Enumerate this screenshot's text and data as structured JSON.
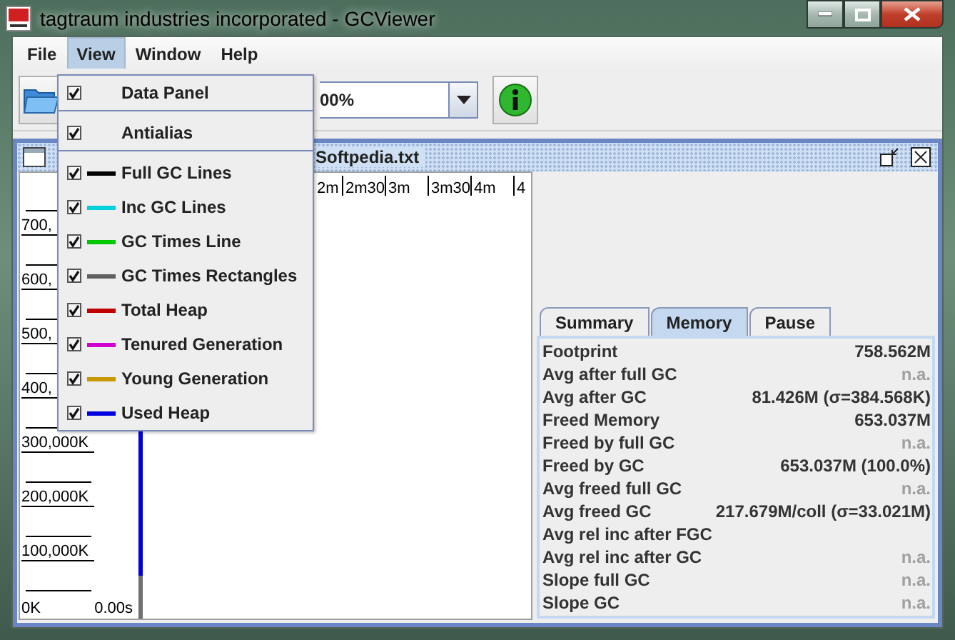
{
  "window": {
    "title": "tagtraum industries incorporated - GCViewer"
  },
  "menu_bar": [
    {
      "label": "File",
      "selected": false
    },
    {
      "label": "View",
      "selected": true
    },
    {
      "label": "Window",
      "selected": false
    },
    {
      "label": "Help",
      "selected": false
    }
  ],
  "view_menu": [
    {
      "kind": "check",
      "label": "Data Panel",
      "checked": true
    },
    {
      "kind": "separator"
    },
    {
      "kind": "check",
      "label": "Antialias",
      "checked": true
    },
    {
      "kind": "separator"
    },
    {
      "kind": "check",
      "label": "Full GC Lines",
      "checked": true,
      "color": "#000000"
    },
    {
      "kind": "check",
      "label": "Inc GC Lines",
      "checked": true,
      "color": "#00d0d8"
    },
    {
      "kind": "check",
      "label": "GC Times Line",
      "checked": true,
      "color": "#00c800"
    },
    {
      "kind": "check",
      "label": "GC Times Rectangles",
      "checked": true,
      "color": "#606060"
    },
    {
      "kind": "check",
      "label": "Total Heap",
      "checked": true,
      "color": "#c00000"
    },
    {
      "kind": "check",
      "label": "Tenured Generation",
      "checked": true,
      "color": "#d000d0"
    },
    {
      "kind": "check",
      "label": "Young Generation",
      "checked": true,
      "color": "#c89800"
    },
    {
      "kind": "check",
      "label": "Used Heap",
      "checked": true,
      "color": "#0000e0"
    }
  ],
  "toolbar": {
    "zoom": {
      "value": "00%"
    }
  },
  "document": {
    "title": "Softpedia.txt",
    "chart": {
      "time_labels": [
        "2m",
        "2m30",
        "3m",
        "3m30",
        "4m",
        "4"
      ],
      "heap_labels": [
        "700,",
        "600,",
        "500,",
        "400,",
        "300,000K",
        "200,000K",
        "100,000K",
        "0K"
      ],
      "time_origin": "0.00s"
    },
    "data_panel": {
      "tabs": [
        {
          "label": "Summary",
          "selected": false
        },
        {
          "label": "Memory",
          "selected": true
        },
        {
          "label": "Pause",
          "selected": false
        }
      ],
      "rows": [
        {
          "label": "Footprint",
          "value": "758.562M",
          "muted": false
        },
        {
          "label": "Avg after full GC",
          "value": "n.a.",
          "muted": true
        },
        {
          "label": "Avg after GC",
          "value": "81.426M (σ=384.568K)",
          "muted": false
        },
        {
          "label": "Freed Memory",
          "value": "653.037M",
          "muted": false
        },
        {
          "label": "Freed by full GC",
          "value": "n.a.",
          "muted": true
        },
        {
          "label": "Freed by GC",
          "value": "653.037M (100.0%)",
          "muted": false
        },
        {
          "label": "Avg freed full GC",
          "value": "n.a.",
          "muted": true
        },
        {
          "label": "Avg freed GC",
          "value": "217.679M/coll (σ=33.021M)",
          "muted": false
        },
        {
          "label": "Avg rel inc after FGC"
        },
        {
          "label": "Avg rel inc after GC",
          "value": "n.a.",
          "muted": true
        },
        {
          "label": "Slope full GC",
          "value": "n.a.",
          "muted": true
        },
        {
          "label": "Slope GC",
          "value": "n.a.",
          "muted": true
        }
      ]
    }
  }
}
